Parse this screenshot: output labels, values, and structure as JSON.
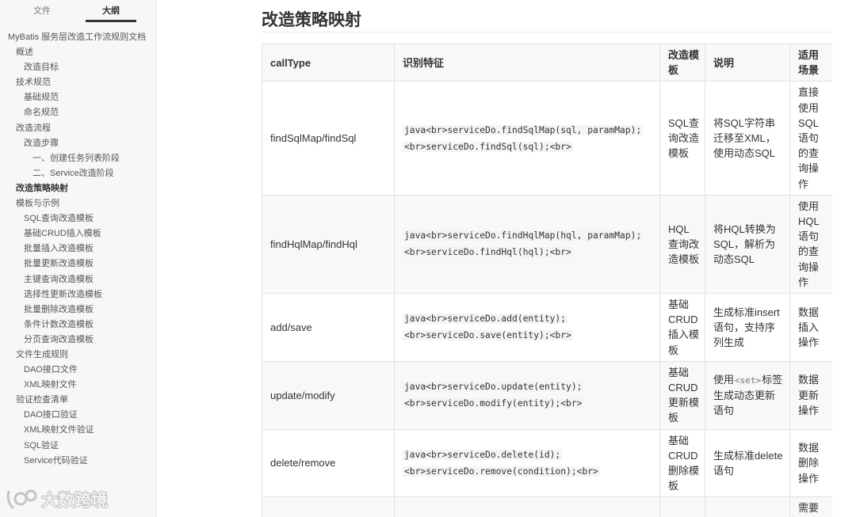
{
  "sidebar": {
    "tabs": [
      {
        "label": "文件",
        "active": false
      },
      {
        "label": "大纲",
        "active": true
      }
    ],
    "outline": [
      {
        "label": "MyBatis 服务层改造工作流规则文档",
        "level": 0
      },
      {
        "label": "概述",
        "level": 1
      },
      {
        "label": "改造目标",
        "level": 2
      },
      {
        "label": "技术规范",
        "level": 1
      },
      {
        "label": "基础规范",
        "level": 2
      },
      {
        "label": "命名规范",
        "level": 2
      },
      {
        "label": "改造流程",
        "level": 1
      },
      {
        "label": "改造步骤",
        "level": 2
      },
      {
        "label": "一、创建任务列表阶段",
        "level": 3
      },
      {
        "label": "二、Service改造阶段",
        "level": 3
      },
      {
        "label": "改造策略映射",
        "level": 1,
        "active": true
      },
      {
        "label": "模板与示例",
        "level": 1
      },
      {
        "label": "SQL查询改造模板",
        "level": 2
      },
      {
        "label": "基础CRUD插入模板",
        "level": 2
      },
      {
        "label": "批量插入改造模板",
        "level": 2
      },
      {
        "label": "批量更新改造模板",
        "level": 2
      },
      {
        "label": "主键查询改造模板",
        "level": 2
      },
      {
        "label": "选择性更新改造模板",
        "level": 2
      },
      {
        "label": "批量删除改造模板",
        "level": 2
      },
      {
        "label": "条件计数改造模板",
        "level": 2
      },
      {
        "label": "分页查询改造模板",
        "level": 2
      },
      {
        "label": "文件生成规则",
        "level": 1
      },
      {
        "label": "DAO接口文件",
        "level": 2
      },
      {
        "label": "XML映射文件",
        "level": 2
      },
      {
        "label": "验证检查清单",
        "level": 1
      },
      {
        "label": "DAO接口验证",
        "level": 2
      },
      {
        "label": "XML映射文件验证",
        "level": 2
      },
      {
        "label": "SQL验证",
        "level": 2
      },
      {
        "label": "Service代码验证",
        "level": 2
      }
    ]
  },
  "document": {
    "heading": "改造策略映射",
    "table": {
      "headers": [
        "callType",
        "识别特征",
        "改造模板",
        "说明",
        "适用场景"
      ],
      "rows": [
        {
          "call_type": "findSqlMap/findSql",
          "features": [
            "java<br>serviceDo.findSqlMap(sql, paramMap);",
            "<br>serviceDo.findSql(sql);<br>"
          ],
          "template": "SQL查询改造模板",
          "desc": [
            {
              "text": "将SQL字符串迁移至XML，使用动态SQL"
            }
          ],
          "scene": "直接使用SQL语句的查询操作"
        },
        {
          "call_type": "findHqlMap/findHql",
          "features": [
            "java<br>serviceDo.findHqlMap(hql, paramMap);",
            "<br>serviceDo.findHql(hql);<br>"
          ],
          "template": "HQL查询改造模板",
          "desc": [
            {
              "text": "将HQL转换为SQL，解析为动态SQL"
            }
          ],
          "scene": "使用HQL语句的查询操作"
        },
        {
          "call_type": "add/save",
          "features": [
            "java<br>serviceDo.add(entity);",
            "<br>serviceDo.save(entity);<br>"
          ],
          "template": "基础CRUD插入模板",
          "desc": [
            {
              "text": "生成标准insert语句，支持序列生成"
            }
          ],
          "scene": "数据插入操作"
        },
        {
          "call_type": "update/modify",
          "features": [
            "java<br>serviceDo.update(entity);",
            "<br>serviceDo.modify(entity);<br>"
          ],
          "template": "基础CRUD更新模板",
          "desc": [
            {
              "text": "使用"
            },
            {
              "text": "<set>",
              "code": true
            },
            {
              "text": "标签生成动态更新语句"
            }
          ],
          "scene": "数据更新操作"
        },
        {
          "call_type": "delete/remove",
          "features": [
            "java<br>serviceDo.delete(id);",
            "<br>serviceDo.remove(condition);<br>"
          ],
          "template": "基础CRUD删除模板",
          "desc": [
            {
              "text": "生成标准delete语句"
            }
          ],
          "scene": "数据删除操作"
        },
        {
          "scene": "需要"
        }
      ]
    }
  },
  "watermark": {
    "text": "大数跨境"
  },
  "colors": {
    "sidebar_bg": "#f7f7f7",
    "text": "#333333",
    "table_border": "#dfe2e5",
    "row_stripe": "#f8f8f8",
    "code_bg": "#f3f4f4"
  }
}
